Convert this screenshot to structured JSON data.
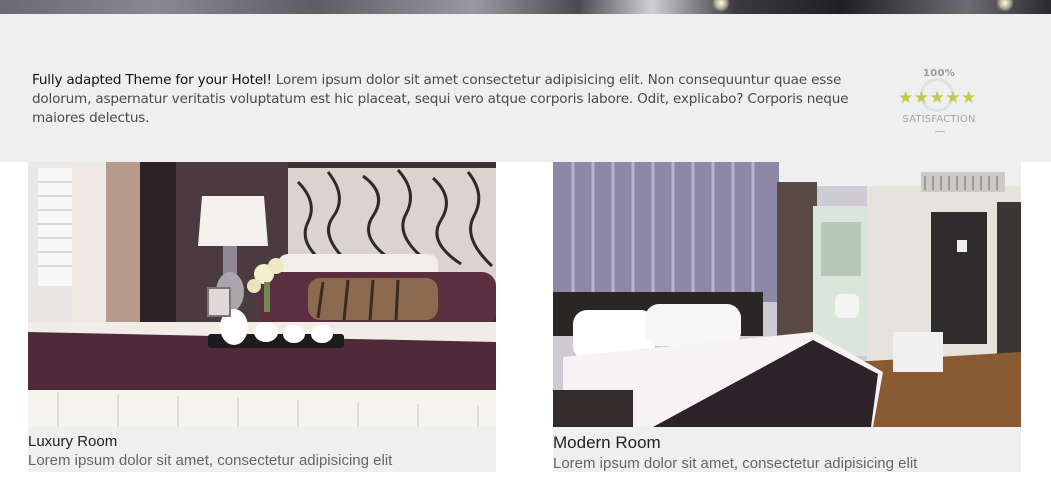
{
  "intro": {
    "lead": "Fully adapted Theme for your Hotel!",
    "body": " Lorem ipsum dolor sit amet consectetur adipisicing elit. Non consequuntur quae esse dolorum, aspernatur veritatis voluptatum est hic placeat, sequi vero atque corporis labore. Odit, explicabo? Corporis neque maiores delectus."
  },
  "badge": {
    "percent": "100%",
    "stars": "★★★★★",
    "rating": 5,
    "label": "SATISFACTION"
  },
  "rooms": [
    {
      "title": "Luxury Room",
      "description": "Lorem ipsum dolor sit amet, consectetur adipisicing elit"
    },
    {
      "title": "Modern Room",
      "description": "Lorem ipsum dolor sit amet, consectetur adipisicing elit"
    }
  ]
}
